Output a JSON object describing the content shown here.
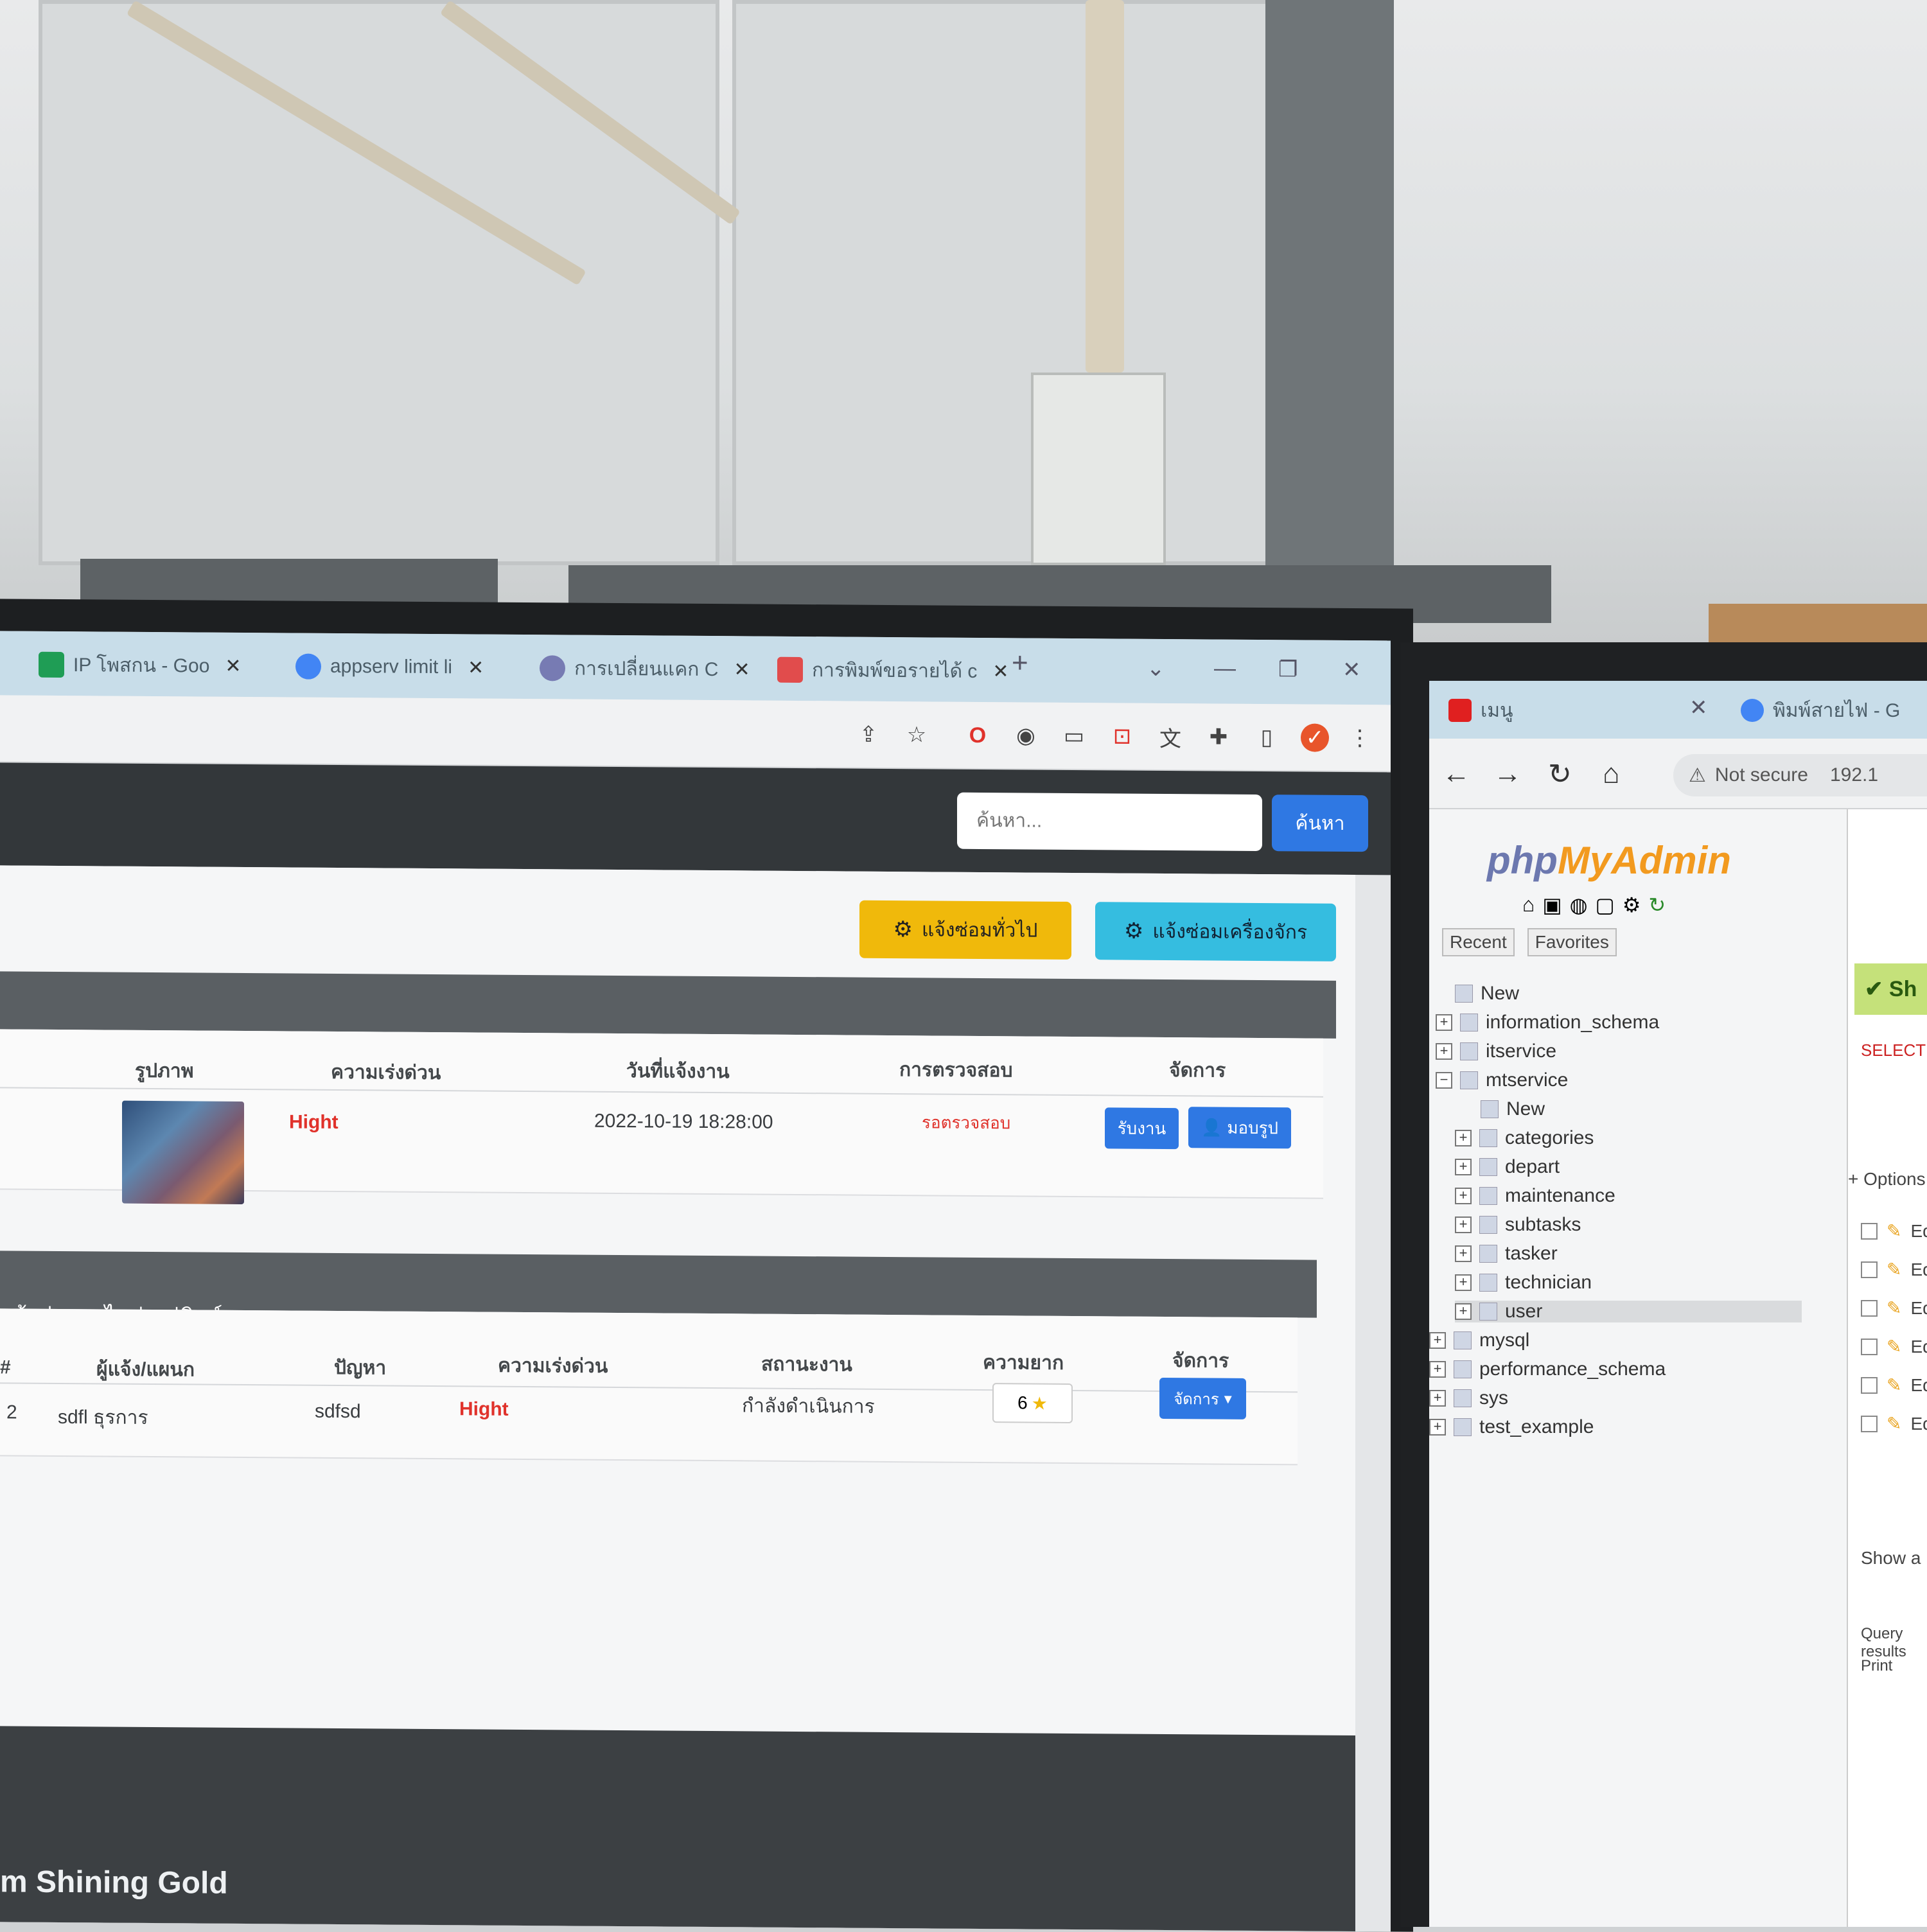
{
  "left_browser": {
    "tabs": [
      {
        "title": "IP โพสกน - Goo",
        "icon": "sheets-icon",
        "color": "#1f9d55"
      },
      {
        "title": "appserv limit li",
        "icon": "google-icon",
        "color": "#4285f4"
      },
      {
        "title": "การเปลี่ยนแคก C",
        "icon": "php-icon",
        "color": "#777bb3"
      },
      {
        "title": "การพิมพ์ขอรายได้ c",
        "icon": "pma-icon",
        "color": "#e14c4c"
      }
    ],
    "tab_close": "✕",
    "new_tab": "+",
    "window_controls": {
      "dropdown": "⌄",
      "minimize": "—",
      "maximize": "❐",
      "close": "✕"
    },
    "toolbar_icons": [
      "share-icon",
      "star-icon",
      "opera-icon",
      "ext-icon",
      "cast-icon",
      "record-icon",
      "translate-icon",
      "puzzle-icon",
      "sidebar-icon",
      "profile-icon",
      "menu-icon"
    ]
  },
  "navbar": {
    "search_placeholder": "ค้นหา...",
    "search_button": "ค้นหา"
  },
  "actions": {
    "general_repair": "แจ้งซ่อมทั่วไป",
    "special_repair": "แจ้งซ่อมเครื่องจักร"
  },
  "table1": {
    "headers": [
      "รูปภาพ",
      "ความเร่งด่วน",
      "วันที่แจ้งงาน",
      "การตรวจสอบ",
      "จัดการ"
    ],
    "row": {
      "priority": "Hight",
      "date": "2022-10-19 18:28:00",
      "check_status": "รอตรวจสอบ",
      "btn_accept": "รับงาน",
      "btn_assign": "มอบรูป"
    }
  },
  "table2": {
    "title": "แจ้งซ่อมอะไหล่-แม่พิมพ์",
    "headers": [
      "#",
      "ผู้แจ้ง/แผนก",
      "ปัญหา",
      "ความเร่งด่วน",
      "สถานะงาน",
      "ความยาก",
      "จัดการ"
    ],
    "row": {
      "num": "2",
      "reporter": "sdfl ธุรการ",
      "problem": "sdfsd",
      "priority": "Hight",
      "status": "กำลังดำเนินการ",
      "difficulty": "6",
      "action": "จัดการ"
    }
  },
  "footer": {
    "text": "m Shining Gold"
  },
  "right_browser": {
    "tab_title": "เมนู",
    "tab2_title": "พิมพ์สายไฟ - G",
    "not_secure": "Not secure",
    "address": "192.1",
    "pma": {
      "logo_php": "php",
      "logo_my": "MyAdmin",
      "tabs": [
        "Recent",
        "Favorites"
      ],
      "tree": [
        {
          "label": "New",
          "level": 0
        },
        {
          "label": "information_schema",
          "level": 0
        },
        {
          "label": "itservice",
          "level": 0
        },
        {
          "label": "mtservice",
          "level": 0
        },
        {
          "label": "New",
          "level": 1
        },
        {
          "label": "categories",
          "level": 1
        },
        {
          "label": "depart",
          "level": 1
        },
        {
          "label": "maintenance",
          "level": 1
        },
        {
          "label": "subtasks",
          "level": 1
        },
        {
          "label": "tasker",
          "level": 1
        },
        {
          "label": "technician",
          "level": 1
        },
        {
          "label": "user",
          "level": 1
        },
        {
          "label": "mysql",
          "level": 0
        },
        {
          "label": "performance_schema",
          "level": 0
        },
        {
          "label": "sys",
          "level": 0
        },
        {
          "label": "test_example",
          "level": 0
        }
      ],
      "success": "✔ Sh",
      "select_snippet": "SELECT",
      "options": "+ Options",
      "edit_label": "Edi",
      "show_all": "Show a",
      "query_results": "Query results",
      "print": "Print"
    }
  }
}
